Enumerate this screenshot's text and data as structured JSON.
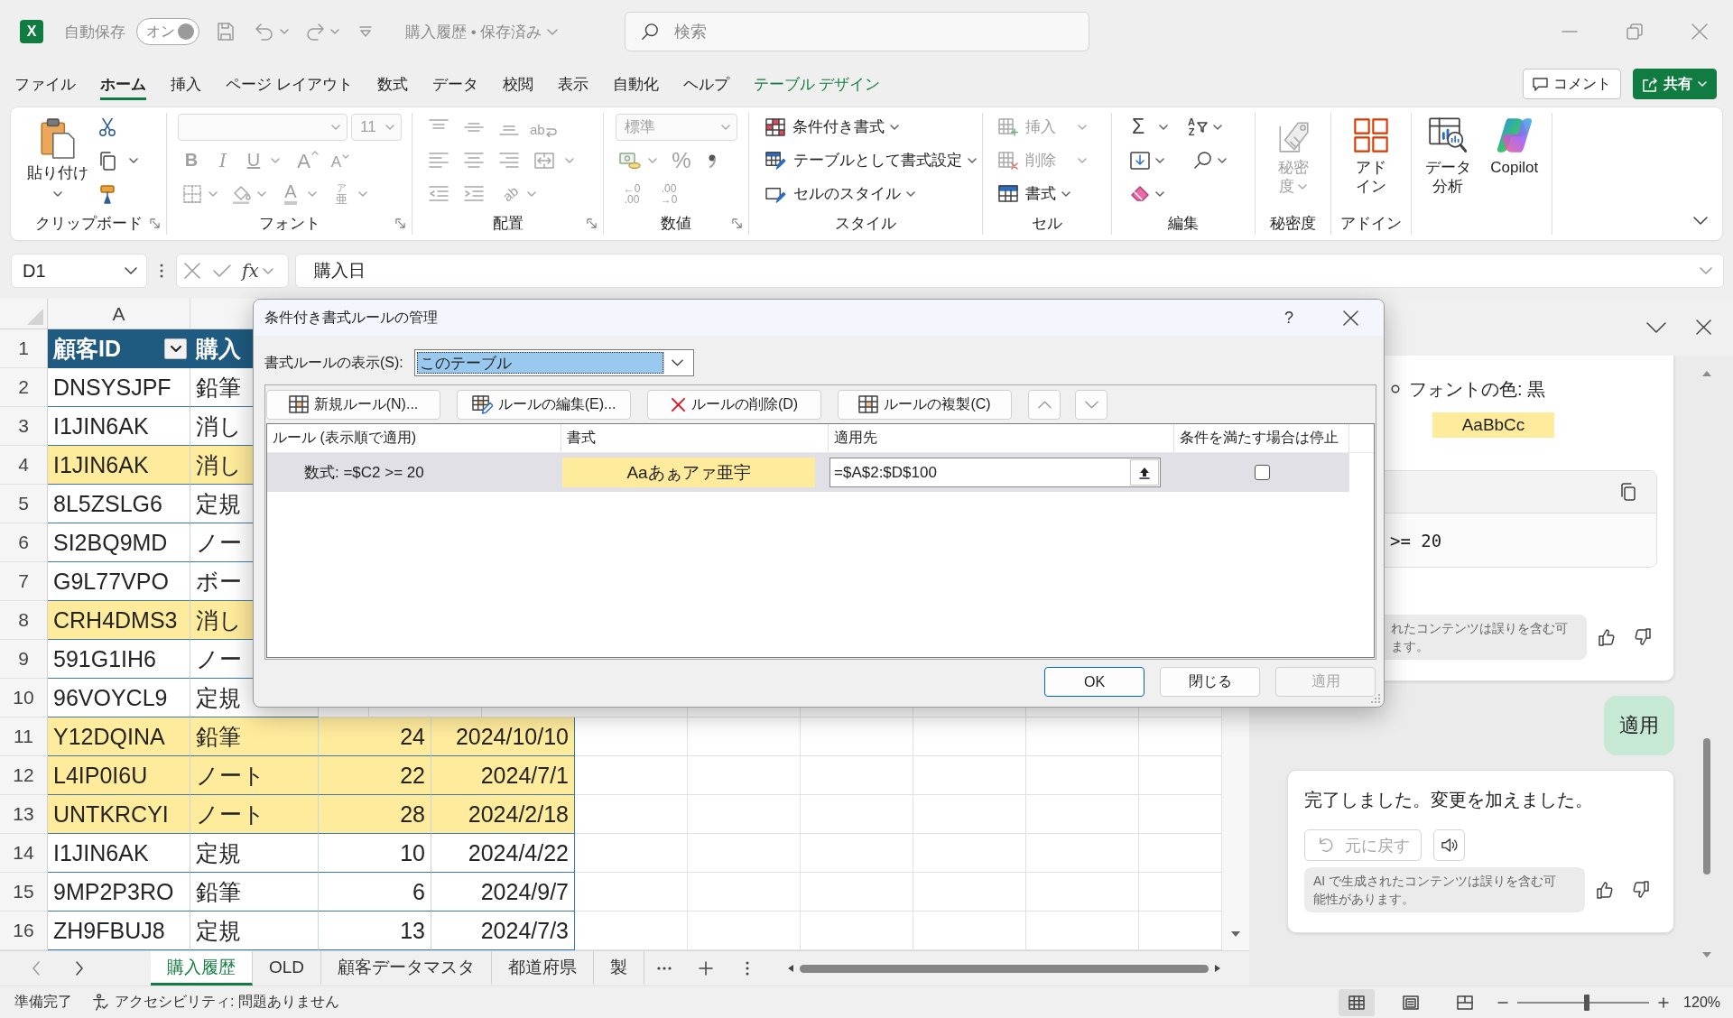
{
  "title_bar": {
    "logo": "X",
    "autosave": {
      "label": "自動保存",
      "state_label": "オン",
      "on": true
    },
    "document": "購入履歴 • 保存済み",
    "search": {
      "placeholder": "検索"
    }
  },
  "menu_tabs": [
    {
      "label": "ファイル",
      "kind": "normal",
      "selected": false
    },
    {
      "label": "ホーム",
      "kind": "normal",
      "selected": true
    },
    {
      "label": "挿入",
      "kind": "normal",
      "selected": false
    },
    {
      "label": "ページ レイアウト",
      "kind": "normal",
      "selected": false
    },
    {
      "label": "数式",
      "kind": "normal",
      "selected": false
    },
    {
      "label": "データ",
      "kind": "normal",
      "selected": false
    },
    {
      "label": "校閲",
      "kind": "normal",
      "selected": false
    },
    {
      "label": "表示",
      "kind": "normal",
      "selected": false
    },
    {
      "label": "自動化",
      "kind": "normal",
      "selected": false
    },
    {
      "label": "ヘルプ",
      "kind": "normal",
      "selected": false
    },
    {
      "label": "テーブル デザイン",
      "kind": "contextual",
      "selected": false
    }
  ],
  "header_buttons": [
    {
      "label": "コメント",
      "kind": "outline"
    },
    {
      "label": "共有",
      "kind": "primary"
    }
  ],
  "ribbon": {
    "groups": [
      {
        "kind": "clipboard",
        "label": "クリップボード",
        "launcher": true,
        "paste": "貼り付け"
      },
      {
        "kind": "font",
        "label": "フォント",
        "launcher": true,
        "disabled": true,
        "font_size": "11",
        "bold": "B",
        "italic": "I",
        "underline": "U",
        "grow": "A",
        "shrink": "A",
        "font_color": "A",
        "phonetic": [
          "ア",
          "亜"
        ]
      },
      {
        "kind": "alignment",
        "label": "配置",
        "launcher": true,
        "disabled": true,
        "wrap": "ab",
        "orientation": "ab"
      },
      {
        "kind": "number",
        "label": "数値",
        "launcher": true,
        "disabled": true,
        "format": "標準",
        "percent": "%",
        "increase_decimal": [
          "←0",
          ".00"
        ],
        "decrease_decimal": [
          ".00",
          "→0"
        ]
      },
      {
        "kind": "styles",
        "label": "スタイル",
        "items": [
          "条件付き書式",
          "テーブルとして書式設定",
          "セルのスタイル"
        ]
      },
      {
        "kind": "cells",
        "label": "セル",
        "items": [
          {
            "label": "挿入",
            "disabled": true
          },
          {
            "label": "削除",
            "disabled": true
          },
          {
            "label": "書式",
            "disabled": false
          }
        ]
      },
      {
        "kind": "editing",
        "label": "編集",
        "sum": "Σ",
        "sort": [
          "A",
          "Z"
        ]
      },
      {
        "kind": "sensitivity",
        "label": "秘密度",
        "lines": [
          "秘密",
          "度"
        ],
        "disabled": true
      },
      {
        "kind": "addins",
        "label": "アドイン",
        "lines": [
          "アド",
          "イン"
        ]
      },
      {
        "kind": "tools",
        "items": [
          {
            "kind": "analysis",
            "lines": [
              "データ",
              "分析"
            ]
          },
          {
            "kind": "copilot",
            "lines": [
              "Copilot"
            ]
          }
        ]
      }
    ]
  },
  "formula_bar": {
    "name_box": "D1",
    "fx": "fx",
    "value": "購入日"
  },
  "sheet": {
    "column_headers": [
      "A"
    ],
    "table_header": {
      "row": "1",
      "cells": [
        "顧客ID",
        "購入"
      ]
    },
    "rows": [
      {
        "row": "2",
        "cells": [
          "DNSYSJPF",
          "鉛筆"
        ],
        "highlight": false
      },
      {
        "row": "3",
        "cells": [
          "I1JIN6AK",
          "消し"
        ],
        "highlight": false
      },
      {
        "row": "4",
        "cells": [
          "I1JIN6AK",
          "消し"
        ],
        "highlight": true
      },
      {
        "row": "5",
        "cells": [
          "8L5ZSLG6",
          "定規"
        ],
        "highlight": false
      },
      {
        "row": "6",
        "cells": [
          "SI2BQ9MD",
          "ノー"
        ],
        "highlight": false
      },
      {
        "row": "7",
        "cells": [
          "G9L77VPO",
          "ボー"
        ],
        "highlight": false
      },
      {
        "row": "8",
        "cells": [
          "CRH4DMS3",
          "消し"
        ],
        "highlight": true
      },
      {
        "row": "9",
        "cells": [
          "591G1IH6",
          "ノー"
        ],
        "highlight": false
      },
      {
        "row": "10",
        "cells": [
          "96VOYCL9",
          "定規"
        ],
        "highlight": false
      },
      {
        "row": "11",
        "cells": [
          "Y12DQINA",
          "鉛筆",
          "24",
          "2024/10/10"
        ],
        "highlight": true
      },
      {
        "row": "12",
        "cells": [
          "L4IP0I6U",
          "ノート",
          "22",
          "2024/7/1"
        ],
        "highlight": true
      },
      {
        "row": "13",
        "cells": [
          "UNTKRCYI",
          "ノート",
          "28",
          "2024/2/18"
        ],
        "highlight": true
      },
      {
        "row": "14",
        "cells": [
          "I1JIN6AK",
          "定規",
          "10",
          "2024/4/22"
        ],
        "highlight": false
      },
      {
        "row": "15",
        "cells": [
          "9MP2P3RO",
          "鉛筆",
          "6",
          "2024/9/7"
        ],
        "highlight": false
      },
      {
        "row": "16",
        "cells": [
          "ZH9FBUJ8",
          "定規",
          "13",
          "2024/7/3"
        ],
        "highlight": false
      }
    ]
  },
  "sheet_tabs": [
    {
      "label": "購入履歴",
      "selected": true
    },
    {
      "label": "OLD",
      "selected": false
    },
    {
      "label": "顧客データマスタ",
      "selected": false
    },
    {
      "label": "都道府県",
      "selected": false
    },
    {
      "label": "製",
      "selected": false
    }
  ],
  "status_bar": {
    "ready": "準備完了",
    "accessibility": "アクセシビリティ: 問題ありません",
    "views": [
      {
        "kind": "normal",
        "selected": true
      },
      {
        "kind": "page_layout",
        "selected": false
      },
      {
        "kind": "page_break",
        "selected": false
      }
    ],
    "zoom": {
      "level": 0.53,
      "reading": "120%"
    }
  },
  "copilot": {
    "bullet": "フォントの色: 黒",
    "sample": "AaBbCc",
    "code": ">= 20",
    "disclaimer_1": [
      "れたコンテンツは誤りを含む可",
      "ます。"
    ],
    "user_message": "適用",
    "reply": "完了しました。変更を加えました。",
    "undo": {
      "label": "元に戻す",
      "disabled": true
    },
    "disclaimer_2": [
      "AI で生成されたコンテンツは誤りを含む可",
      "能性があります。"
    ]
  },
  "dialog": {
    "title": "条件付き書式ルールの管理",
    "help": "?",
    "show_label": "書式ルールの表示(S):",
    "show_value": "このテーブル",
    "toolbar": [
      {
        "label": "新規ルール(N)...",
        "kind": "new"
      },
      {
        "label": "ルールの編集(E)...",
        "kind": "edit"
      },
      {
        "label": "ルールの削除(D)",
        "kind": "delete"
      },
      {
        "label": "ルールの複製(C)",
        "kind": "duplicate"
      }
    ],
    "columns": [
      "ルール (表示順で適用)",
      "書式",
      "適用先",
      "条件を満たす場合は停止"
    ],
    "rules": [
      {
        "rule": "数式: =$C2 >= 20",
        "preview": "Aaあぁアァ亜宇",
        "applies_to": "=$A$2:$D$100",
        "stop_if_true": false,
        "selected": true
      }
    ],
    "buttons": [
      {
        "label": "OK",
        "kind": "default",
        "disabled": false
      },
      {
        "label": "閉じる",
        "kind": "normal",
        "disabled": false
      },
      {
        "label": "適用",
        "kind": "normal",
        "disabled": true
      }
    ]
  }
}
